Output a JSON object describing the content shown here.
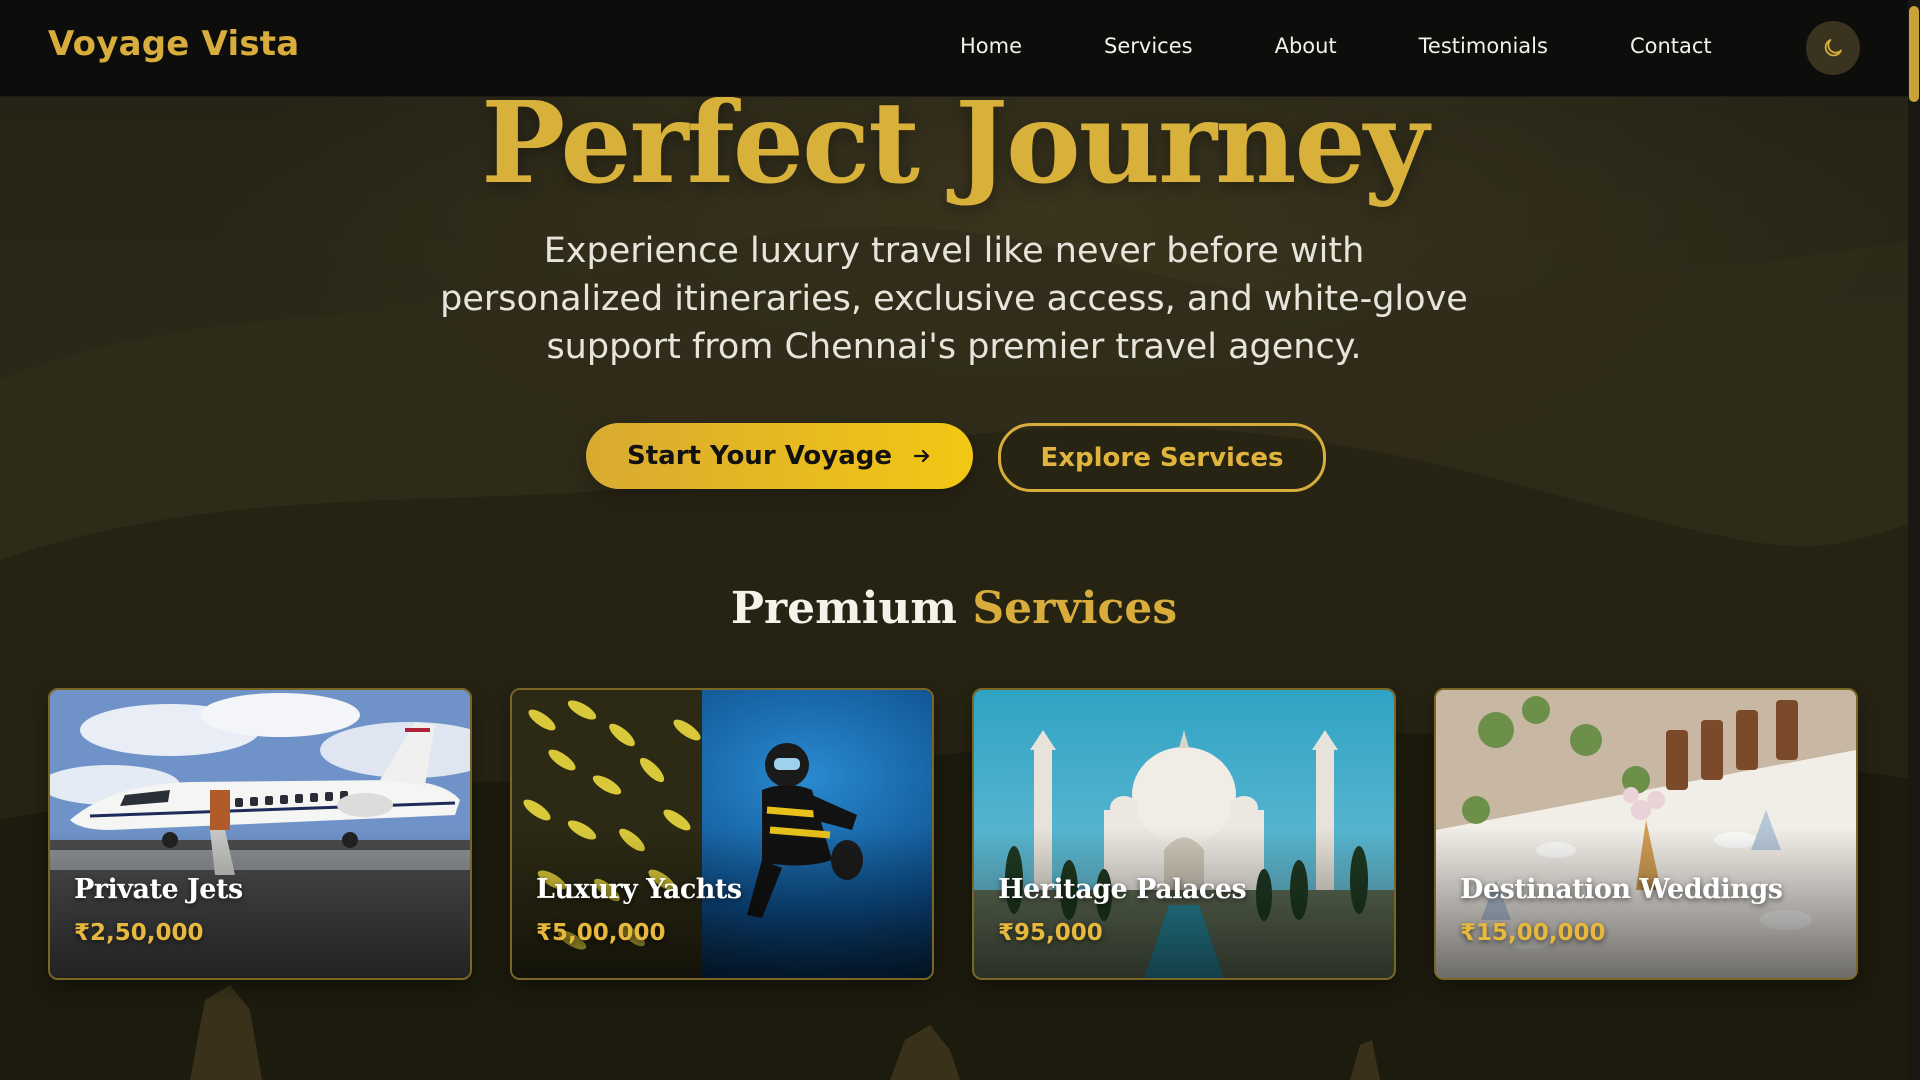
{
  "brand": {
    "name": "Voyage Vista"
  },
  "nav": {
    "items": [
      {
        "label": "Home"
      },
      {
        "label": "Services"
      },
      {
        "label": "About"
      },
      {
        "label": "Testimonials"
      },
      {
        "label": "Contact"
      }
    ],
    "theme_toggle_icon": "moon-icon"
  },
  "hero": {
    "title": "Perfect Journey",
    "subtitle_lines": [
      "Experience luxury travel like never before with",
      "personalized itineraries, exclusive access, and white-glove",
      "support from Chennai's premier travel agency."
    ],
    "primary_cta": "Start Your Voyage",
    "primary_cta_icon": "arrow-right-icon",
    "secondary_cta": "Explore Services"
  },
  "services": {
    "title_main": "Premium",
    "title_accent": "Services",
    "cards": [
      {
        "title": "Private Jets",
        "price": "₹2,50,000"
      },
      {
        "title": "Luxury Yachts",
        "price": "₹5,00,000"
      },
      {
        "title": "Heritage Palaces",
        "price": "₹95,000"
      },
      {
        "title": "Destination Weddings",
        "price": "₹15,00,000"
      }
    ]
  },
  "colors": {
    "accent_gold": "#d8ad3c",
    "navbar_bg": "#0d0d0c",
    "primary_button": "#f3c713"
  }
}
